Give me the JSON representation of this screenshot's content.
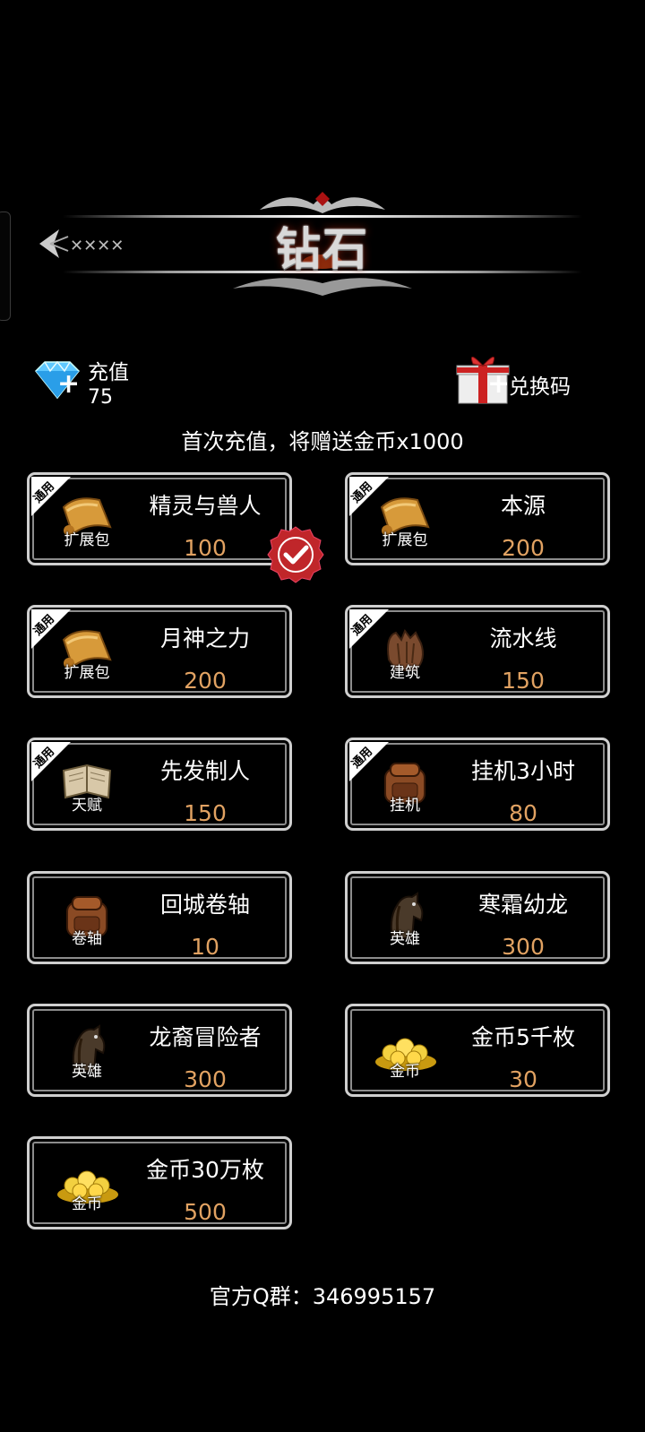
{
  "header": {
    "title": "钻石"
  },
  "recharge": {
    "label": "充值",
    "count": "75"
  },
  "redeem": {
    "label": "兑换码"
  },
  "promo_text": "首次充值，将赠送金币x1000",
  "ribbon_text": "通用",
  "items": [
    {
      "name": "精灵与兽人",
      "price": "100",
      "category": "扩展包",
      "icon": "scroll-icon",
      "ribbon": true,
      "selected": true
    },
    {
      "name": "本源",
      "price": "200",
      "category": "扩展包",
      "icon": "scroll-icon",
      "ribbon": true
    },
    {
      "name": "月神之力",
      "price": "200",
      "category": "扩展包",
      "icon": "scroll-icon",
      "ribbon": true
    },
    {
      "name": "流水线",
      "price": "150",
      "category": "建筑",
      "icon": "fist-icon",
      "ribbon": true
    },
    {
      "name": "先发制人",
      "price": "150",
      "category": "天赋",
      "icon": "book-icon",
      "ribbon": true
    },
    {
      "name": "挂机3小时",
      "price": "80",
      "category": "挂机",
      "icon": "backpack-icon",
      "ribbon": true
    },
    {
      "name": "回城卷轴",
      "price": "10",
      "category": "卷轴",
      "icon": "backpack-icon",
      "ribbon": false
    },
    {
      "name": "寒霜幼龙",
      "price": "300",
      "category": "英雄",
      "icon": "horse-icon",
      "ribbon": false
    },
    {
      "name": "龙裔冒险者",
      "price": "300",
      "category": "英雄",
      "icon": "horse-icon",
      "ribbon": false
    },
    {
      "name": "金币5千枚",
      "price": "30",
      "category": "金币",
      "icon": "gold-coins-icon",
      "ribbon": false
    },
    {
      "name": "金币30万枚",
      "price": "500",
      "category": "金币",
      "icon": "gold-coins-icon",
      "ribbon": false
    }
  ],
  "footer": {
    "text": "官方Q群：346995157"
  },
  "colors": {
    "price": "#e1a262",
    "badge_red": "#c0262a",
    "border": "#cfcfcf"
  }
}
